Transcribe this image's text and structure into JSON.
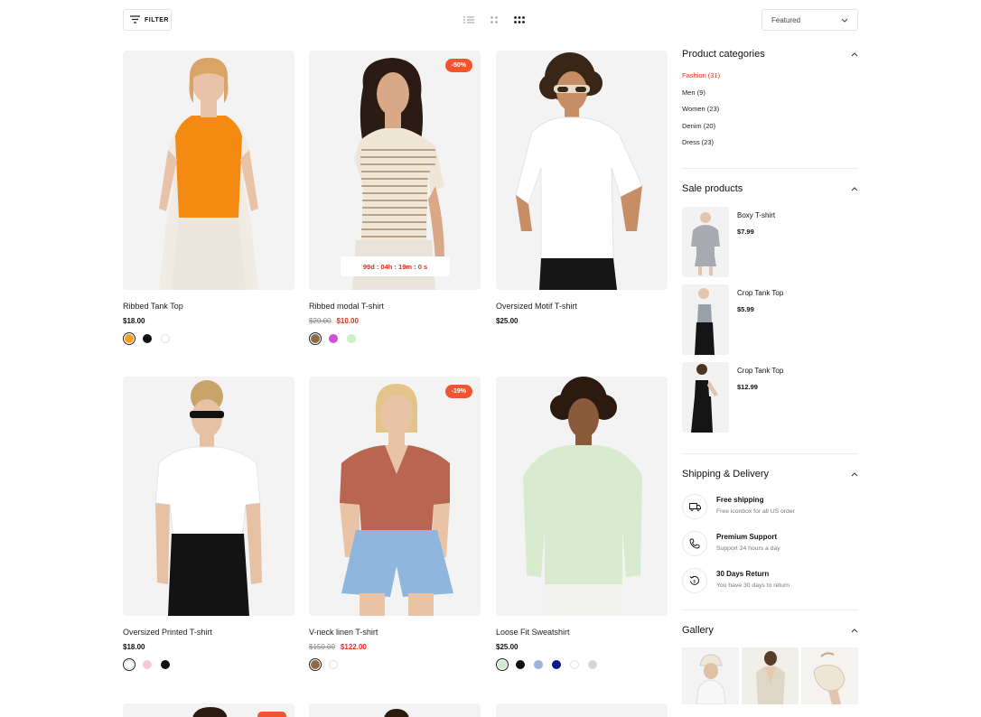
{
  "toolbar": {
    "filter_label": "FILTER",
    "sort_value": "Featured"
  },
  "products": [
    {
      "name": "Ribbed Tank Top",
      "price": "$18.00"
    },
    {
      "name": "Ribbed modal T-shirt",
      "old_price": "$20.00",
      "price": "$10.00",
      "badge": "-50%",
      "timer": "99d : 04h : 19m : 0 s"
    },
    {
      "name": "Oversized Motif T-shirt",
      "price": "$25.00"
    },
    {
      "name": "Oversized Printed T-shirt",
      "price": "$18.00"
    },
    {
      "name": "V-neck linen T-shirt",
      "old_price": "$150.00",
      "price": "$122.00",
      "badge": "-19%"
    },
    {
      "name": "Loose Fit Sweatshirt",
      "price": "$25.00"
    }
  ],
  "swatch_colors": {
    "p0": [
      "#f5a11c",
      "#111111",
      "#ffffff"
    ],
    "p1": [
      "#8b6a44",
      "#cf4fd4",
      "#c6f2c6"
    ],
    "p3": [
      "#ffffff",
      "#f7c7d6",
      "#111111"
    ],
    "p4": [
      "#8b6a44",
      "#ffffff"
    ],
    "p5": [
      "#cdebcf",
      "#111111",
      "#9db2d4",
      "#0a1a8a",
      "#ffffff",
      "#d6d6d6"
    ]
  },
  "sidebar": {
    "categories_title": "Product categories",
    "categories": [
      "Fashion (31)",
      "Men (9)",
      "Women (23)",
      "Denim (20)",
      "Dress (23)"
    ],
    "sale_title": "Sale products",
    "sale": [
      {
        "name": "Boxy T-shirt",
        "price": "$7.99"
      },
      {
        "name": "Crop Tank Top",
        "price": "$5.99"
      },
      {
        "name": "Crop Tank Top",
        "price": "$12.99"
      }
    ],
    "shipping_title": "Shipping & Delivery",
    "shipping": [
      {
        "title": "Free shipping",
        "sub": "Free iconbox for all US order",
        "icon": "truck-icon"
      },
      {
        "title": "Premium Support",
        "sub": "Support 24 hours a day",
        "icon": "phone-icon"
      },
      {
        "title": "30 Days Return",
        "sub": "You have 30 days to return",
        "icon": "return-icon"
      }
    ],
    "gallery_title": "Gallery"
  },
  "colors": {
    "accent": "#e0301e",
    "badge": "#f0552f"
  }
}
